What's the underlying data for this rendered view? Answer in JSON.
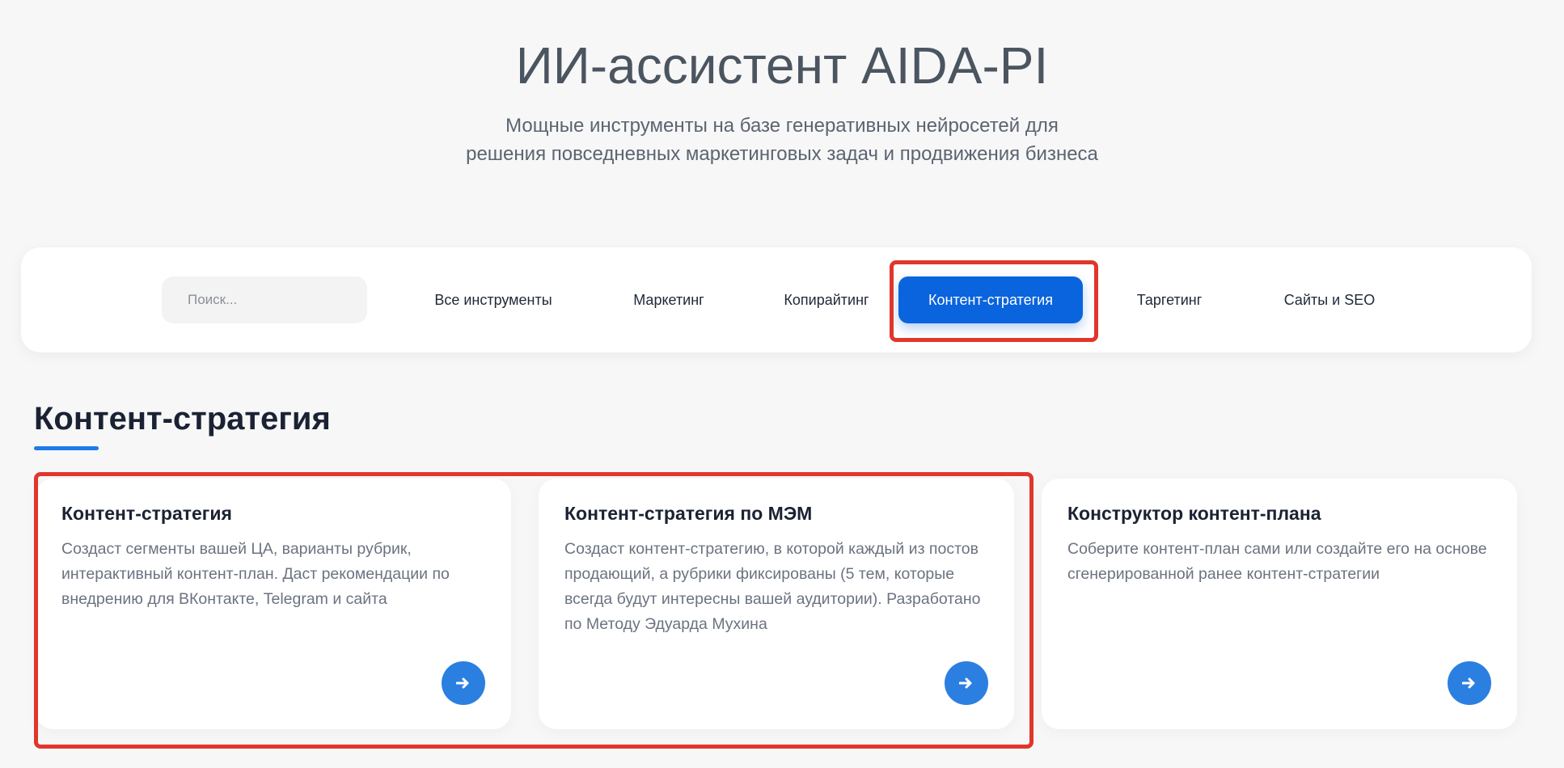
{
  "hero": {
    "title": "ИИ-ассистент AIDA-PI",
    "subtitle_line1": "Мощные инструменты на базе генеративных нейросетей для",
    "subtitle_line2": "решения повседневных маркетинговых задач и продвижения бизнеса"
  },
  "filters": {
    "search_placeholder": "Поиск...",
    "tabs": [
      {
        "label": "Все инструменты"
      },
      {
        "label": "Маркетинг"
      },
      {
        "label": "Копирайтинг"
      },
      {
        "label": "Контент-стратегия",
        "active": true
      },
      {
        "label": "Таргетинг"
      },
      {
        "label": "Сайты и SEO"
      }
    ]
  },
  "section": {
    "title": "Контент-стратегия"
  },
  "cards": [
    {
      "title": "Контент-стратегия",
      "description": "Создаст сегменты вашей ЦА, варианты рубрик, интерактивный контент-план. Даст рекомендации по внедрению для ВКонтакте, Telegram и сайта",
      "button_icon": "arrow-right-icon"
    },
    {
      "title": "Контент-стратегия по МЭМ",
      "description": "Создаст контент-стратегию, в которой каждый из постов продающий, а рубрики фиксированы (5 тем, которые всегда будут интересны вашей аудитории). Разработано по Методу Эдуарда Мухина",
      "button_icon": "arrow-right-icon"
    },
    {
      "title": "Конструктор контент-плана",
      "description": "Соберите контент-план сами или создайте его на основе сгенерированной ранее контент-стратегии",
      "button_icon": "arrow-right-icon"
    }
  ],
  "colors": {
    "accent": "#0a64dd",
    "button": "#2b7fe0",
    "highlight": "#e0362c",
    "background": "#f7f7f8"
  }
}
